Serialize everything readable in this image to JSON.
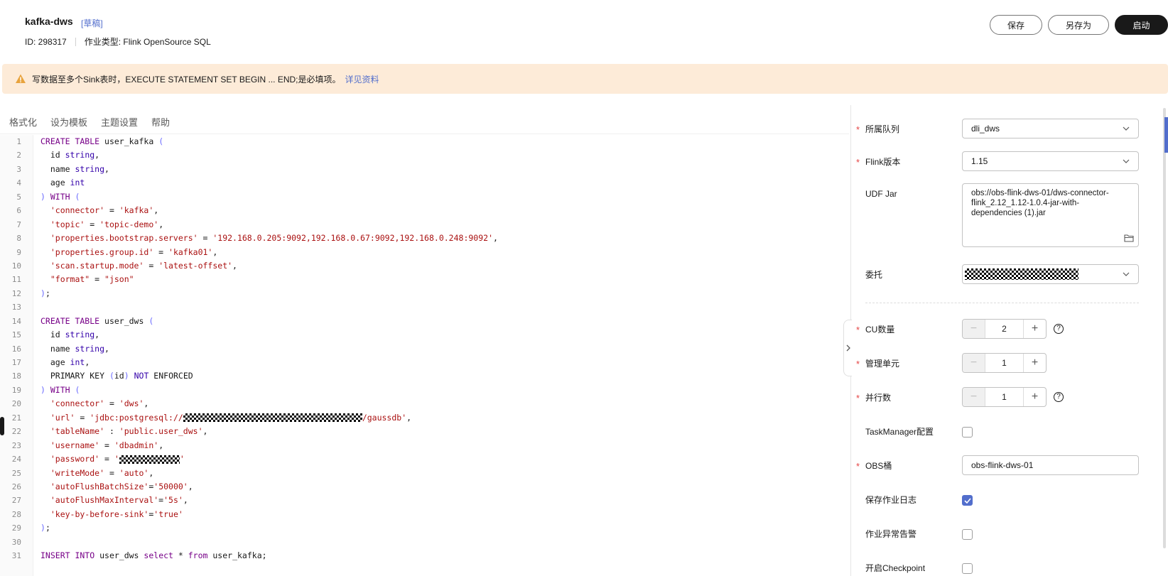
{
  "header": {
    "job_title": "kafka-dws",
    "draft_tag": "[草稿]",
    "job_id": "ID: 298317",
    "job_type": "作业类型: Flink OpenSource SQL",
    "save_label": "保存",
    "save_as_label": "另存为",
    "start_label": "启动"
  },
  "alert": {
    "message": "写数据至多个Sink表时，EXECUTE STATEMENT SET BEGIN ... END;是必填项。",
    "link": "详见资料"
  },
  "toolbar": {
    "format": "格式化",
    "set_template": "设为模板",
    "theme": "主题设置",
    "help": "帮助"
  },
  "code": {
    "l1a": "CREATE TABLE",
    "l1b": " user_kafka ",
    "l1c": "(",
    "l2a": "  id ",
    "l2b": "string",
    "l2c": ",",
    "l3a": "  name ",
    "l3b": "string",
    "l3c": ",",
    "l4a": "  age ",
    "l4b": "int",
    "l5a": ")",
    "l5b": " WITH ",
    "l5c": "(",
    "l6a": "  'connector'",
    "l6b": " = ",
    "l6c": "'kafka'",
    "l6d": ",",
    "l7a": "  'topic'",
    "l7b": " = ",
    "l7c": "'topic-demo'",
    "l7d": ",",
    "l8a": "  'properties.bootstrap.servers'",
    "l8b": " = ",
    "l8c": "'192.168.0.205:9092,192.168.0.67:9092,192.168.0.248:9092'",
    "l8d": ",",
    "l9a": "  'properties.group.id'",
    "l9b": " = ",
    "l9c": "'kafka01'",
    "l9d": ",",
    "l10a": "  'scan.startup.mode'",
    "l10b": " = ",
    "l10c": "'latest-offset'",
    "l10d": ",",
    "l11a": "  \"format\"",
    "l11b": " = ",
    "l11c": "\"json\"",
    "l12a": ")",
    "l12b": ";",
    "l14a": "CREATE TABLE",
    "l14b": " user_dws ",
    "l14c": "(",
    "l15a": "  id ",
    "l15b": "string",
    "l15c": ",",
    "l16a": "  name ",
    "l16b": "string",
    "l16c": ",",
    "l17a": "  age ",
    "l17b": "int",
    "l17c": ",",
    "l18a": "  PRIMARY KEY ",
    "l18b": "(",
    "l18c": "id",
    "l18d": ")",
    "l18e": " NOT",
    "l18f": " ENFORCED",
    "l19a": ")",
    "l19b": " WITH ",
    "l19c": "(",
    "l20a": "  'connector'",
    "l20b": " = ",
    "l20c": "'dws'",
    "l20d": ",",
    "l21a": "  'url'",
    "l21b": " = ",
    "l21c": "'jdbc:postgresql://",
    "l21d": "/gaussdb'",
    "l21e": ",",
    "l22a": "  'tableName'",
    "l22b": " : ",
    "l22c": "'public.user_dws'",
    "l22d": ",",
    "l23a": "  'username'",
    "l23b": " = ",
    "l23c": "'dbadmin'",
    "l23d": ",",
    "l24a": "  'password'",
    "l24b": " = ",
    "l24c": "'",
    "l24d": "'",
    "l25a": "  'writeMode'",
    "l25b": " = ",
    "l25c": "'auto'",
    "l25d": ",",
    "l26a": "  'autoFlushBatchSize'",
    "l26b": "=",
    "l26c": "'50000'",
    "l26d": ",",
    "l27a": "  'autoFlushMaxInterval'",
    "l27b": "=",
    "l27c": "'5s'",
    "l27d": ",",
    "l28a": "  'key-by-before-sink'",
    "l28b": "=",
    "l28c": "'true'",
    "l29a": ")",
    "l29b": ";",
    "l31a": "INSERT INTO",
    "l31b": " user_dws ",
    "l31c": "select",
    "l31d": " * ",
    "l31e": "from",
    "l31f": " user_kafka;"
  },
  "line_numbers": [
    "1",
    "2",
    "3",
    "4",
    "5",
    "6",
    "7",
    "8",
    "9",
    "10",
    "11",
    "12",
    "13",
    "14",
    "15",
    "16",
    "17",
    "18",
    "19",
    "20",
    "21",
    "22",
    "23",
    "24",
    "25",
    "26",
    "27",
    "28",
    "29",
    "30",
    "31"
  ],
  "panel": {
    "queue_label": "所属队列",
    "queue_value": "dli_dws",
    "flink_label": "Flink版本",
    "flink_value": "1.15",
    "udf_label": "UDF Jar",
    "udf_value": "obs://obs-flink-dws-01/dws-connector-flink_2.12_1.12-1.0.4-jar-with-dependencies (1).jar",
    "delegate_label": "委托",
    "cu_label": "CU数量",
    "cu_value": "2",
    "mgmt_label": "管理单元",
    "mgmt_value": "1",
    "parallel_label": "并行数",
    "parallel_value": "1",
    "tm_label": "TaskManager配置",
    "obs_label": "OBS桶",
    "obs_value": "obs-flink-dws-01",
    "save_log_label": "保存作业日志",
    "alarm_label": "作业异常告警",
    "checkpoint_label": "开启Checkpoint",
    "help_glyph": "?",
    "save_log_checked": true,
    "tm_checked": false,
    "alarm_checked": false,
    "checkpoint_checked": false
  },
  "icons": {
    "alert": "warning-triangle-icon",
    "chevron": "chevron-down-icon",
    "folder": "folder-icon",
    "collapse": "chevron-right-icon"
  },
  "colors": {
    "accent": "#526ecc",
    "alert_bg": "#fdebd8",
    "alert_icon": "#e8a33d",
    "required": "#e54545",
    "primary_button": "#191919"
  }
}
